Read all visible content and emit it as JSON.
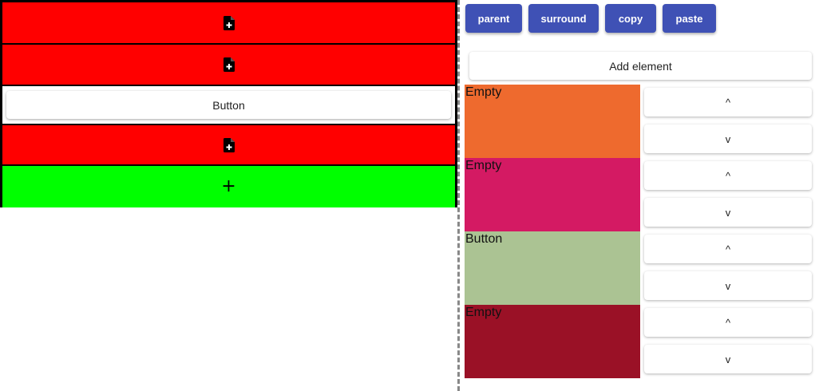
{
  "canvas": {
    "slots": [
      {
        "kind": "empty",
        "icon": "add-document-icon",
        "color": "#ff0000"
      },
      {
        "kind": "empty",
        "icon": "add-document-icon",
        "color": "#ff0000"
      },
      {
        "kind": "button",
        "label": "Button"
      },
      {
        "kind": "empty",
        "icon": "add-document-icon",
        "color": "#ff0000"
      },
      {
        "kind": "add",
        "icon": "plus-icon",
        "symbol": "+",
        "color": "#00ff00"
      }
    ]
  },
  "toolbar": {
    "parent_label": "parent",
    "surround_label": "surround",
    "copy_label": "copy",
    "paste_label": "paste",
    "accent_color": "#3f51b5"
  },
  "editor": {
    "add_element_label": "Add element",
    "children": [
      {
        "label": "Empty",
        "color": "#ee6a2e",
        "up_label": "^",
        "down_label": "v"
      },
      {
        "label": "Empty",
        "color": "#d41a63",
        "up_label": "^",
        "down_label": "v"
      },
      {
        "label": "Button",
        "color": "#abc393",
        "up_label": "^",
        "down_label": "v"
      },
      {
        "label": "Empty",
        "color": "#9a1126",
        "up_label": "^",
        "down_label": "v"
      }
    ]
  }
}
